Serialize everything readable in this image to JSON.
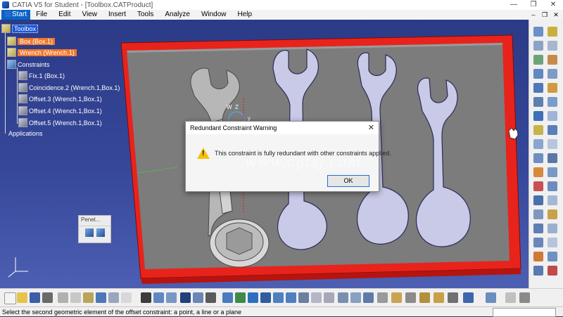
{
  "window": {
    "title": "CATIA V5 for Student - [Toolbox.CATProduct]",
    "controls": [
      "—",
      "❐",
      "✕"
    ]
  },
  "menu": {
    "items": [
      "Start",
      "File",
      "Edit",
      "View",
      "Insert",
      "Tools",
      "Analyze",
      "Window",
      "Help"
    ]
  },
  "tree": {
    "root": "Toolbox",
    "box": "Box (Box.1)",
    "wrench": "Wrench (Wrench.1)",
    "constraints": "Constraints",
    "c1": "Fix.1 (Box.1)",
    "c2": "Coincidence.2 (Wrench.1,Box.1)",
    "c3": "Offset.3 (Wrench.1,Box.1)",
    "c4": "Offset.4 (Wrench.1,Box.1)",
    "c5": "Offset.5 (Wrench.1,Box.1)",
    "applications": "Applications"
  },
  "dialog": {
    "title": "Redundant Constraint Warning",
    "message": "This constraint is fully redundant with other constraints applied.",
    "ok_label": "OK",
    "watermark": "www.cgtsj.com"
  },
  "penet_panel": {
    "title": "Penet..."
  },
  "axis_labels": {
    "w": "W",
    "z": "Z",
    "y": "y"
  },
  "status": {
    "text": "Select the second geometric element of the offset constraint: a point, a line or a plane"
  },
  "colors": {
    "viewport_top": "#2c3b86",
    "box_red": "#e8231c",
    "tray_gray": "#7c7c7c",
    "wrench_fill": "#c9c9e8",
    "highlight_orange": "#f0772d",
    "selection_blue": "#1a56d6"
  }
}
